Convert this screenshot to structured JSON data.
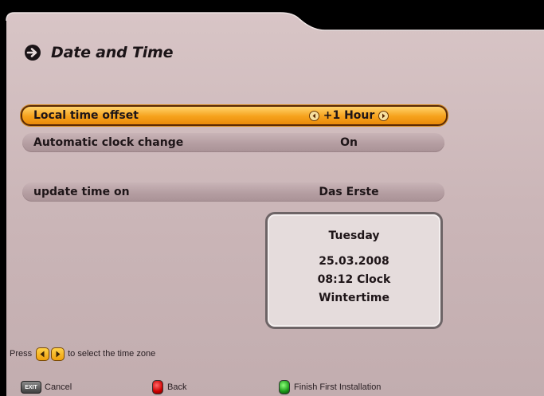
{
  "title": "Date and Time",
  "settings": [
    {
      "label": "Local time offset",
      "value": "+1 Hour",
      "selected": true
    },
    {
      "label": "Automatic clock change",
      "value": "On",
      "selected": false
    }
  ],
  "update_setting": {
    "label": "update time on",
    "value": "Das Erste"
  },
  "info": {
    "day": "Tuesday",
    "date": "25.03.2008",
    "time": "08:12 Clock",
    "season": "Wintertime"
  },
  "hint": {
    "prefix": "Press",
    "suffix": "to select the time zone"
  },
  "footer": {
    "cancel_key_label": "EXIT",
    "cancel_label": "Cancel",
    "back_label": "Back",
    "finish_label": "Finish First Installation"
  },
  "colors": {
    "panel": "#cdb9bb",
    "selected_row": "#f6a21c",
    "row": "#b39ca0",
    "text": "#1e1518"
  },
  "icons": {
    "title": "arrow-right-circle-icon",
    "left": "arrow-left-key-icon",
    "right": "arrow-right-key-icon"
  }
}
